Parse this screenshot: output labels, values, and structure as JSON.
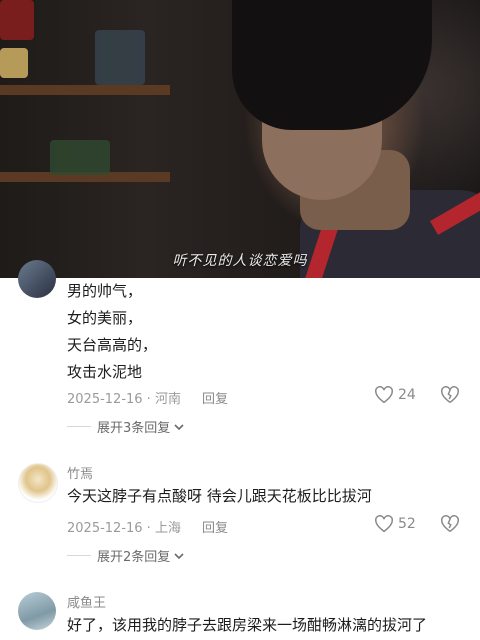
{
  "video": {
    "subtitle": "听不见的人谈恋爱吗"
  },
  "comments": [
    {
      "username": "",
      "lines": [
        "男的帅气，",
        "女的美丽，",
        "天台高高的，",
        "攻击水泥地"
      ],
      "date": "2025-12-16 · 河南",
      "reply_label": "回复",
      "likes": "24",
      "expand_label": "展开3条回复"
    },
    {
      "username": "竹焉",
      "lines": [
        "今天这脖子有点酸呀 待会儿跟天花板比比拔河"
      ],
      "date": "2025-12-16 · 上海",
      "reply_label": "回复",
      "likes": "52",
      "expand_label": "展开2条回复"
    },
    {
      "username": "咸鱼王",
      "lines": [
        "好了，该用我的脖子去跟房梁来一场酣畅淋漓的拔河了"
      ]
    }
  ],
  "icons": {
    "heart": "heart-outline",
    "dislike": "broken-heart-outline",
    "chevron": "chevron-down"
  }
}
